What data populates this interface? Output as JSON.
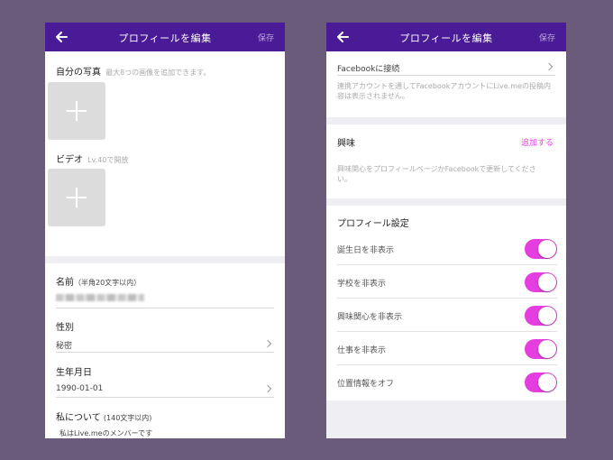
{
  "left": {
    "nav": {
      "title": "プロフィールを編集",
      "save": "保存"
    },
    "photos": {
      "label": "自分の写真",
      "hint": "最大8つの画像を追加できます。"
    },
    "video": {
      "label": "ビデオ",
      "hint": "Lv.40で開放"
    },
    "name": {
      "label": "名前",
      "hint": "（半角20文字以内）"
    },
    "gender": {
      "label": "性別",
      "value": "秘密"
    },
    "birthday": {
      "label": "生年月日",
      "value": "1990-01-01"
    },
    "about": {
      "label": "私について",
      "hint": "(140文字以内)",
      "value": "私はLive.meのメンバーです"
    }
  },
  "right": {
    "nav": {
      "title": "プロフィールを編集",
      "save": "保存"
    },
    "facebook": {
      "label": "Facebookに接続",
      "note": "連携アカウントを通してFacebookアカウントにLive.meの投稿内容は表示されません。"
    },
    "interest": {
      "label": "興味",
      "add": "追加する",
      "note": "興味関心をプロフィールページかFacebookで更新してください。"
    },
    "settings": {
      "title": "プロフィール設定",
      "toggles": [
        {
          "label": "誕生日を非表示",
          "on": true
        },
        {
          "label": "学校を非表示",
          "on": true
        },
        {
          "label": "興味関心を非表示",
          "on": true
        },
        {
          "label": "仕事を非表示",
          "on": true
        },
        {
          "label": "位置情報をオフ",
          "on": true
        }
      ]
    }
  },
  "colors": {
    "nav": "#4a1b96",
    "accent": "#e53ee0",
    "background": "#6b5b7b"
  },
  "icons": {
    "back": "arrow-left-icon",
    "add": "plus-icon",
    "chevron": "chevron-right-icon"
  }
}
